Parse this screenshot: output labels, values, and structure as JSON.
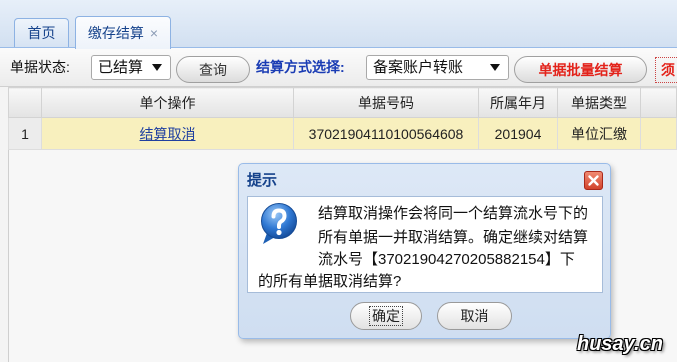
{
  "tabs": [
    {
      "label": "首页"
    },
    {
      "label": "缴存结算",
      "close": "×"
    }
  ],
  "toolbar": {
    "status_label": "单据状态:",
    "status_value": "已结算",
    "query_label": "查询",
    "method_label": "结算方式选择:",
    "method_value": "备案账户转账",
    "batch_label": "单据批量结算",
    "overflow_label": "须"
  },
  "table": {
    "columns": [
      "",
      "单个操作",
      "单据号码",
      "所属年月",
      "单据类型",
      ""
    ],
    "rows": [
      {
        "index": "1",
        "action": "结算取消",
        "bill_no": "37021904110100564608",
        "period": "201904",
        "type": "单位汇缴"
      }
    ]
  },
  "dialog": {
    "title": "提示",
    "icon": "question-icon",
    "close_icon": "close-icon",
    "message_lines": [
      "结算取消操作会将同一个结算流水号下的",
      "所有单据一并取消结算。确定继续对结算",
      "流水号【37021904270205882154】下",
      "的所有单据取消结算?"
    ],
    "ok_label": "确定",
    "cancel_label": "取消"
  },
  "icons": {
    "select_arrow": "chevron-down-icon"
  },
  "watermark": "husay.cn",
  "colors": {
    "tab_text": "#15428b",
    "method_label": "#1a3cb4",
    "batch_text": "#e3231b",
    "link": "#1f3fa0",
    "row_highlight": "#f8f0be",
    "close_button": "#d2432c"
  }
}
